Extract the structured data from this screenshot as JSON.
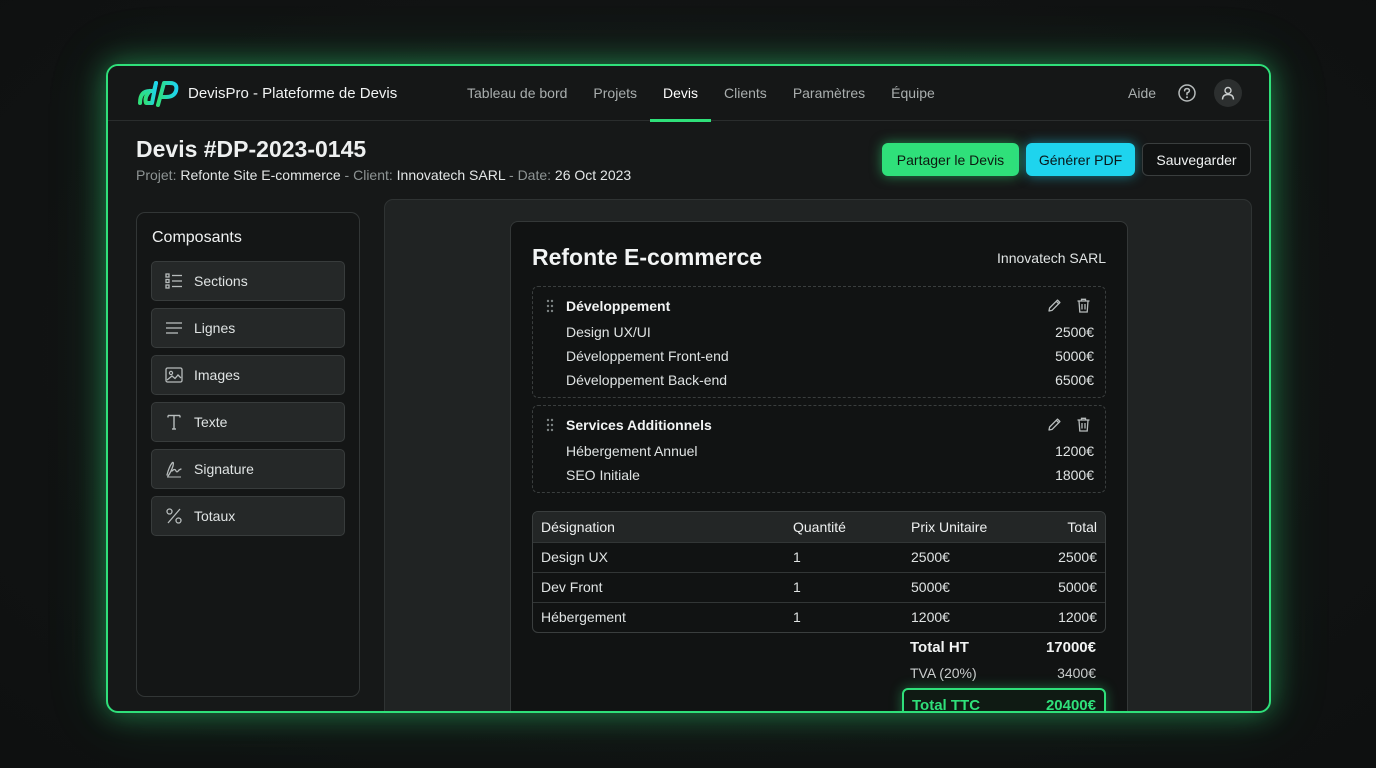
{
  "app": {
    "brand": "DevisPro - Plateforme de Devis"
  },
  "nav": {
    "items": [
      {
        "label": "Tableau de bord"
      },
      {
        "label": "Projets"
      },
      {
        "label": "Devis"
      },
      {
        "label": "Clients"
      },
      {
        "label": "Paramètres"
      },
      {
        "label": "Équipe"
      }
    ],
    "active": "Devis",
    "help": "Aide"
  },
  "header": {
    "title": "Devis #DP-2023-0145",
    "project_label": "Projet:",
    "project_value": "Refonte Site E-commerce",
    "client_label": "- Client:",
    "client_value": "Innovatech SARL",
    "date_label": "- Date:",
    "date_value": "26 Oct 2023"
  },
  "actions": {
    "share": "Partager le Devis",
    "pdf": "Générer PDF",
    "save": "Sauvegarder"
  },
  "components": {
    "title": "Composants",
    "items": [
      {
        "label": "Sections",
        "icon": "list-icon"
      },
      {
        "label": "Lignes",
        "icon": "lines-icon"
      },
      {
        "label": "Images",
        "icon": "image-icon"
      },
      {
        "label": "Texte",
        "icon": "text-icon"
      },
      {
        "label": "Signature",
        "icon": "signature-icon"
      },
      {
        "label": "Totaux",
        "icon": "percent-icon"
      }
    ]
  },
  "document": {
    "title": "Refonte E-commerce",
    "client": "Innovatech SARL",
    "sections": [
      {
        "title": "Développement",
        "rows": [
          {
            "label": "Design UX/UI",
            "amount": "2500€"
          },
          {
            "label": "Développement Front-end",
            "amount": "5000€"
          },
          {
            "label": "Développement Back-end",
            "amount": "6500€"
          }
        ]
      },
      {
        "title": "Services Additionnels",
        "rows": [
          {
            "label": "Hébergement Annuel",
            "amount": "1200€"
          },
          {
            "label": "SEO Initiale",
            "amount": "1800€"
          }
        ]
      }
    ],
    "table": {
      "headers": [
        "Désignation",
        "Quantité",
        "Prix Unitaire",
        "Total"
      ],
      "rows": [
        [
          "Design UX",
          "1",
          "2500€",
          "2500€"
        ],
        [
          "Dev Front",
          "1",
          "5000€",
          "5000€"
        ],
        [
          "Hébergement",
          "1",
          "1200€",
          "1200€"
        ]
      ]
    },
    "totals": {
      "ht_label": "Total HT",
      "ht_value": "17000€",
      "tva_label": "TVA (20%)",
      "tva_value": "3400€",
      "ttc_label": "Total TTC",
      "ttc_value": "20400€"
    }
  },
  "colors": {
    "accent": "#2fe07a",
    "pdf": "#1ed4ee"
  }
}
